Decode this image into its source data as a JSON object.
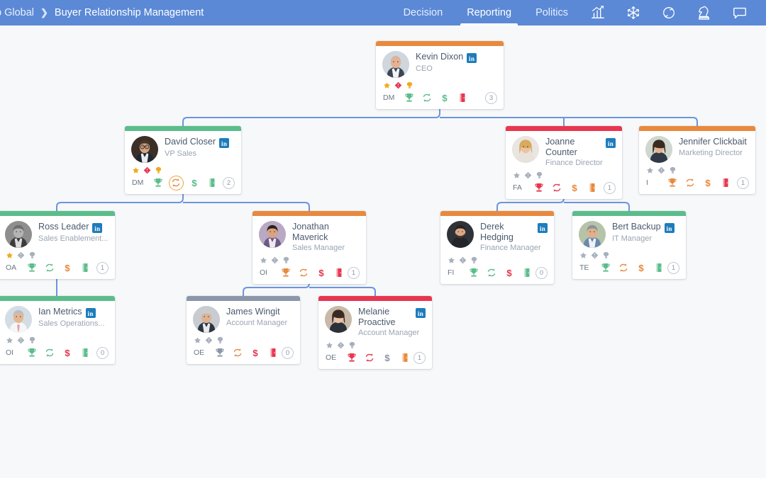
{
  "header": {
    "breadcrumb": [
      {
        "label": "p Global",
        "current": false
      },
      {
        "label": "Buyer Relationship Management",
        "current": true
      }
    ],
    "separator": "❯",
    "tabs": [
      {
        "label": "Decision",
        "active": false
      },
      {
        "label": "Reporting",
        "active": true
      },
      {
        "label": "Politics",
        "active": false
      }
    ],
    "icons": [
      {
        "name": "bar-chart-icon"
      },
      {
        "name": "snowflake-icon"
      },
      {
        "name": "refresh-sync-icon"
      },
      {
        "name": "chess-knight-icon"
      },
      {
        "name": "speech-bubble-icon"
      }
    ],
    "bar_color": "#5b89d6"
  },
  "legend": {
    "colors": {
      "green": "#5bbd8b",
      "orange": "#e8893e",
      "red": "#e8364f",
      "gray": "#8b97a8",
      "blue_link": "#5b89d6",
      "gold": "#efaa1e"
    }
  },
  "nodes": [
    {
      "id": "kevin",
      "name": "Kevin Dixon",
      "title": "CEO",
      "bar": "orange",
      "linkedin": true,
      "avatar": "male-bald-suit",
      "badges": [
        {
          "name": "star-badge",
          "state": "gold"
        },
        {
          "name": "diamond-badge",
          "state": "red"
        },
        {
          "name": "medal-badge",
          "state": "gold"
        }
      ],
      "initials": "DM",
      "icons": [
        {
          "name": "trophy-icon",
          "color": "green",
          "highlight": false
        },
        {
          "name": "refresh-icon",
          "color": "green",
          "highlight": false
        },
        {
          "name": "dollar-icon",
          "color": "green",
          "highlight": false
        },
        {
          "name": "book-icon",
          "color": "red",
          "highlight": false
        }
      ],
      "count": "3"
    },
    {
      "id": "david",
      "name": "David Closer",
      "title": "VP Sales",
      "bar": "green",
      "linkedin": true,
      "avatar": "male-glasses-suit",
      "badges": [
        {
          "name": "star-badge",
          "state": "gold"
        },
        {
          "name": "diamond-badge",
          "state": "red"
        },
        {
          "name": "medal-badge",
          "state": "gold"
        }
      ],
      "initials": "DM",
      "icons": [
        {
          "name": "trophy-icon",
          "color": "green",
          "highlight": false
        },
        {
          "name": "refresh-icon",
          "color": "orange",
          "highlight": true
        },
        {
          "name": "dollar-icon",
          "color": "green",
          "highlight": false
        },
        {
          "name": "book-icon",
          "color": "green",
          "highlight": false
        }
      ],
      "count": "2"
    },
    {
      "id": "joanne",
      "name": "Joanne Counter",
      "title": "Finance Director",
      "bar": "red",
      "linkedin": true,
      "avatar": "female-blonde",
      "badges": [
        {
          "name": "star-badge",
          "state": "gray"
        },
        {
          "name": "diamond-badge",
          "state": "gray"
        },
        {
          "name": "medal-badge",
          "state": "gray"
        }
      ],
      "initials": "FA",
      "icons": [
        {
          "name": "trophy-icon",
          "color": "red",
          "highlight": false
        },
        {
          "name": "refresh-icon",
          "color": "red",
          "highlight": false
        },
        {
          "name": "dollar-icon",
          "color": "orange",
          "highlight": false
        },
        {
          "name": "book-icon",
          "color": "orange",
          "highlight": false
        }
      ],
      "count": "1"
    },
    {
      "id": "jennifer",
      "name": "Jennifer Clickbait",
      "title": "Marketing Director",
      "bar": "orange",
      "linkedin": false,
      "avatar": "female-dark-curly",
      "badges": [
        {
          "name": "star-badge",
          "state": "gray"
        },
        {
          "name": "diamond-badge",
          "state": "gray"
        },
        {
          "name": "medal-badge",
          "state": "gray"
        }
      ],
      "initials": "I",
      "icons": [
        {
          "name": "trophy-icon",
          "color": "orange",
          "highlight": false
        },
        {
          "name": "refresh-icon",
          "color": "orange",
          "highlight": false
        },
        {
          "name": "dollar-icon",
          "color": "orange",
          "highlight": false
        },
        {
          "name": "book-icon",
          "color": "red",
          "highlight": false
        }
      ],
      "count": "1"
    },
    {
      "id": "ross",
      "name": "Ross Leader",
      "title": "Sales Enablement...",
      "bar": "green",
      "linkedin": true,
      "avatar": "male-gray-bw",
      "badges": [
        {
          "name": "star-badge",
          "state": "gold"
        },
        {
          "name": "diamond-badge",
          "state": "gray"
        },
        {
          "name": "medal-badge",
          "state": "gray"
        }
      ],
      "initials": "OA",
      "icons": [
        {
          "name": "trophy-icon",
          "color": "green",
          "highlight": false
        },
        {
          "name": "refresh-icon",
          "color": "green",
          "highlight": false
        },
        {
          "name": "dollar-icon",
          "color": "orange",
          "highlight": false
        },
        {
          "name": "book-icon",
          "color": "green",
          "highlight": false
        }
      ],
      "count": "1"
    },
    {
      "id": "jonathan",
      "name": "Jonathan Maverick",
      "title": "Sales Manager",
      "bar": "orange",
      "linkedin": false,
      "avatar": "male-purple-shirt",
      "badges": [
        {
          "name": "star-badge",
          "state": "gray"
        },
        {
          "name": "diamond-badge",
          "state": "gray"
        },
        {
          "name": "medal-badge",
          "state": "gray"
        }
      ],
      "initials": "OI",
      "icons": [
        {
          "name": "trophy-icon",
          "color": "orange",
          "highlight": false
        },
        {
          "name": "refresh-icon",
          "color": "orange",
          "highlight": false
        },
        {
          "name": "dollar-icon",
          "color": "red",
          "highlight": false
        },
        {
          "name": "book-icon",
          "color": "red",
          "highlight": false
        }
      ],
      "count": "1"
    },
    {
      "id": "derek",
      "name": "Derek Hedging",
      "title": "Finance Manager",
      "bar": "orange",
      "linkedin": true,
      "avatar": "male-dark-beard",
      "badges": [
        {
          "name": "star-badge",
          "state": "gray"
        },
        {
          "name": "diamond-badge",
          "state": "gray"
        },
        {
          "name": "medal-badge",
          "state": "gray"
        }
      ],
      "initials": "FI",
      "icons": [
        {
          "name": "trophy-icon",
          "color": "green",
          "highlight": false
        },
        {
          "name": "refresh-icon",
          "color": "green",
          "highlight": false
        },
        {
          "name": "dollar-icon",
          "color": "red",
          "highlight": false
        },
        {
          "name": "book-icon",
          "color": "green",
          "highlight": false
        }
      ],
      "count": "0"
    },
    {
      "id": "bert",
      "name": "Bert Backup",
      "title": "IT Manager",
      "bar": "green",
      "linkedin": true,
      "avatar": "male-smiling-blue",
      "badges": [
        {
          "name": "star-badge",
          "state": "gray"
        },
        {
          "name": "diamond-badge",
          "state": "gray"
        },
        {
          "name": "medal-badge",
          "state": "gray"
        }
      ],
      "initials": "TE",
      "icons": [
        {
          "name": "trophy-icon",
          "color": "green",
          "highlight": false
        },
        {
          "name": "refresh-icon",
          "color": "orange",
          "highlight": false
        },
        {
          "name": "dollar-icon",
          "color": "orange",
          "highlight": false
        },
        {
          "name": "book-icon",
          "color": "green",
          "highlight": false
        }
      ],
      "count": "1"
    },
    {
      "id": "ian",
      "name": "Ian Metrics",
      "title": "Sales Operations...",
      "bar": "green",
      "linkedin": true,
      "avatar": "male-white-shirt-tie",
      "badges": [
        {
          "name": "star-badge",
          "state": "gray"
        },
        {
          "name": "diamond-badge",
          "state": "gray"
        },
        {
          "name": "medal-badge",
          "state": "gray"
        }
      ],
      "initials": "OI",
      "icons": [
        {
          "name": "trophy-icon",
          "color": "green",
          "highlight": false
        },
        {
          "name": "refresh-icon",
          "color": "green",
          "highlight": false
        },
        {
          "name": "dollar-icon",
          "color": "red",
          "highlight": false
        },
        {
          "name": "book-icon",
          "color": "green",
          "highlight": false
        }
      ],
      "count": "0"
    },
    {
      "id": "james",
      "name": "James Wingit",
      "title": "Account Manager",
      "bar": "gray",
      "linkedin": false,
      "avatar": "male-senior-gray",
      "badges": [
        {
          "name": "star-badge",
          "state": "gray"
        },
        {
          "name": "diamond-badge",
          "state": "gray"
        },
        {
          "name": "medal-badge",
          "state": "gray"
        }
      ],
      "initials": "OE",
      "icons": [
        {
          "name": "trophy-icon",
          "color": "gray",
          "highlight": false
        },
        {
          "name": "refresh-icon",
          "color": "orange",
          "highlight": false
        },
        {
          "name": "dollar-icon",
          "color": "red",
          "highlight": false
        },
        {
          "name": "book-icon",
          "color": "red",
          "highlight": false
        }
      ],
      "count": "0"
    },
    {
      "id": "melanie",
      "name": "Melanie Proactive",
      "title": "Account Manager",
      "bar": "red",
      "linkedin": true,
      "avatar": "female-short-hair",
      "badges": [
        {
          "name": "star-badge",
          "state": "gray"
        },
        {
          "name": "diamond-badge",
          "state": "gray"
        },
        {
          "name": "medal-badge",
          "state": "gray"
        }
      ],
      "initials": "OE",
      "icons": [
        {
          "name": "trophy-icon",
          "color": "red",
          "highlight": false
        },
        {
          "name": "refresh-icon",
          "color": "red",
          "highlight": false
        },
        {
          "name": "dollar-icon",
          "color": "gray",
          "highlight": false
        },
        {
          "name": "book-icon",
          "color": "orange",
          "highlight": false
        }
      ],
      "count": "1"
    }
  ],
  "edges": [
    {
      "from": "kevin",
      "to": "david"
    },
    {
      "from": "kevin",
      "to": "joanne"
    },
    {
      "from": "kevin",
      "to": "jennifer"
    },
    {
      "from": "david",
      "to": "ross"
    },
    {
      "from": "david",
      "to": "jonathan"
    },
    {
      "from": "joanne",
      "to": "derek"
    },
    {
      "from": "joanne",
      "to": "bert"
    },
    {
      "from": "ross",
      "to": "ian"
    },
    {
      "from": "jonathan",
      "to": "james"
    },
    {
      "from": "jonathan",
      "to": "melanie"
    }
  ]
}
